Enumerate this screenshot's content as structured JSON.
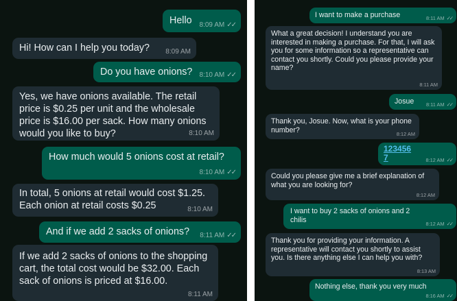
{
  "left_chat": {
    "messages": [
      {
        "dir": "out",
        "text": "Hello",
        "time": "8:09 AM",
        "ticks": "✓✓"
      },
      {
        "dir": "in",
        "text": "Hi! How can I help you today?",
        "time": "8:09 AM"
      },
      {
        "dir": "out",
        "text": "Do you have onions?",
        "time": "8:10 AM",
        "ticks": "✓✓"
      },
      {
        "dir": "in",
        "text": "Yes, we have onions available. The retail price is $0.25 per unit and the wholesale price is $16.00 per sack. How many onions would you like to buy?",
        "time": "8:10 AM"
      },
      {
        "dir": "out",
        "text": "How much would 5 onions cost at retail?",
        "time": "8:10 AM",
        "ticks": "✓✓"
      },
      {
        "dir": "in",
        "text": "In total, 5 onions at retail would cost $1.25. Each onion at retail costs $0.25",
        "time": "8:10 AM"
      },
      {
        "dir": "out",
        "text": "And if we add 2 sacks of onions?",
        "time": "8:11 AM",
        "ticks": "✓✓"
      },
      {
        "dir": "in",
        "text": "If we add 2 sacks of onions to the shopping cart, the total cost would be $32.00. Each sack of onions is priced at $16.00.",
        "time": "8:11 AM"
      }
    ]
  },
  "right_chat": {
    "messages": [
      {
        "dir": "out",
        "text": "I want to make a purchase",
        "time": "8:11 AM",
        "ticks": "✓✓"
      },
      {
        "dir": "in",
        "text": "What a great decision! I understand you are interested in making a purchase. For that, I will ask you for some information so a representative can contact you shortly. Could you please provide your name?",
        "time": "8:11 AM"
      },
      {
        "dir": "out",
        "text": "Josue",
        "time": "8:11 AM",
        "ticks": "✓✓"
      },
      {
        "dir": "in",
        "text": "Thank you, Josue. Now, what is your phone number?",
        "time": "8:12 AM"
      },
      {
        "dir": "out",
        "text": "123456 7",
        "time": "8:12 AM",
        "ticks": "✓✓"
      },
      {
        "dir": "in",
        "text": "Could you please give me a brief explanation of what you are looking for?",
        "time": "8:12 AM"
      },
      {
        "dir": "out",
        "text": "I want to buy 2 sacks of onions and 2 chilis",
        "time": "8:12 AM",
        "ticks": "✓✓"
      },
      {
        "dir": "in",
        "text": "Thank you for providing your information. A representative will contact you shortly to assist you. Is there anything else I can help you with?",
        "time": "8:13 AM"
      },
      {
        "dir": "out",
        "text": "Nothing else, thank you very much",
        "time": "8:16 AM",
        "ticks": "✓✓"
      }
    ]
  }
}
